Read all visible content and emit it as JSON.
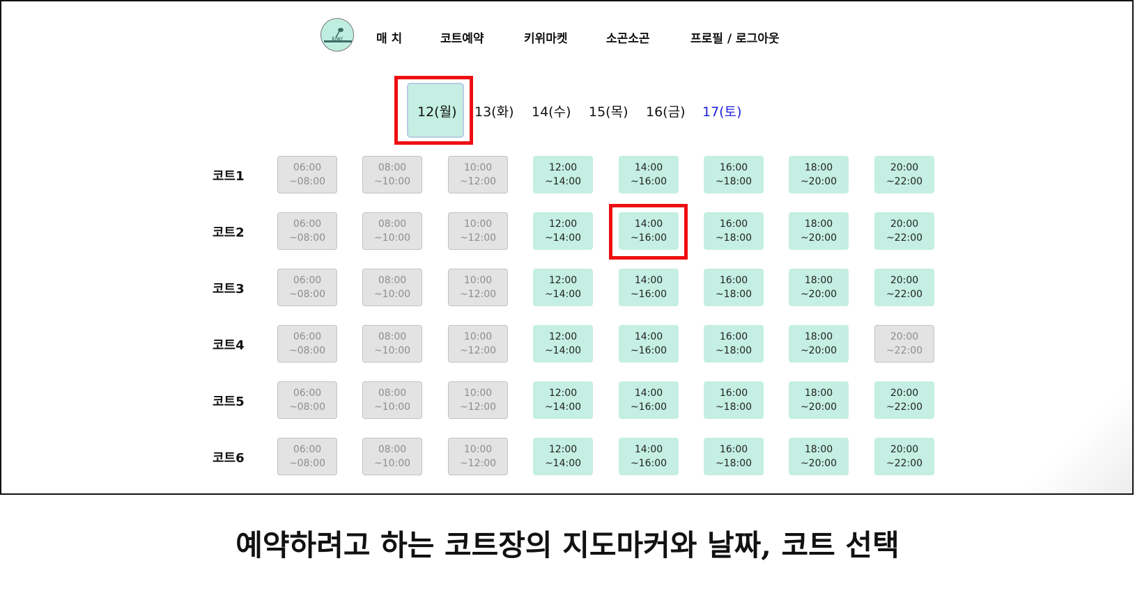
{
  "nav": {
    "logo_text": "kiwi",
    "items": [
      "매 치",
      "코트예약",
      "키위마켓",
      "소곤소곤",
      "프로필 / 로그아웃"
    ]
  },
  "dates": [
    {
      "label": "12(월)",
      "selected": true,
      "saturday": false
    },
    {
      "label": "13(화)",
      "selected": false,
      "saturday": false
    },
    {
      "label": "14(수)",
      "selected": false,
      "saturday": false
    },
    {
      "label": "15(목)",
      "selected": false,
      "saturday": false
    },
    {
      "label": "16(금)",
      "selected": false,
      "saturday": false
    },
    {
      "label": "17(토)",
      "selected": false,
      "saturday": true
    }
  ],
  "courts": [
    {
      "name": "코트1",
      "slots": [
        {
          "start": "06:00",
          "end": "~08:00",
          "available": false
        },
        {
          "start": "08:00",
          "end": "~10:00",
          "available": false
        },
        {
          "start": "10:00",
          "end": "~12:00",
          "available": false
        },
        {
          "start": "12:00",
          "end": "~14:00",
          "available": true
        },
        {
          "start": "14:00",
          "end": "~16:00",
          "available": true
        },
        {
          "start": "16:00",
          "end": "~18:00",
          "available": true
        },
        {
          "start": "18:00",
          "end": "~20:00",
          "available": true
        },
        {
          "start": "20:00",
          "end": "~22:00",
          "available": true
        }
      ]
    },
    {
      "name": "코트2",
      "slots": [
        {
          "start": "06:00",
          "end": "~08:00",
          "available": false
        },
        {
          "start": "08:00",
          "end": "~10:00",
          "available": false
        },
        {
          "start": "10:00",
          "end": "~12:00",
          "available": false
        },
        {
          "start": "12:00",
          "end": "~14:00",
          "available": true
        },
        {
          "start": "14:00",
          "end": "~16:00",
          "available": true
        },
        {
          "start": "16:00",
          "end": "~18:00",
          "available": true
        },
        {
          "start": "18:00",
          "end": "~20:00",
          "available": true
        },
        {
          "start": "20:00",
          "end": "~22:00",
          "available": true
        }
      ]
    },
    {
      "name": "코트3",
      "slots": [
        {
          "start": "06:00",
          "end": "~08:00",
          "available": false
        },
        {
          "start": "08:00",
          "end": "~10:00",
          "available": false
        },
        {
          "start": "10:00",
          "end": "~12:00",
          "available": false
        },
        {
          "start": "12:00",
          "end": "~14:00",
          "available": true
        },
        {
          "start": "14:00",
          "end": "~16:00",
          "available": true
        },
        {
          "start": "16:00",
          "end": "~18:00",
          "available": true
        },
        {
          "start": "18:00",
          "end": "~20:00",
          "available": true
        },
        {
          "start": "20:00",
          "end": "~22:00",
          "available": true
        }
      ]
    },
    {
      "name": "코트4",
      "slots": [
        {
          "start": "06:00",
          "end": "~08:00",
          "available": false
        },
        {
          "start": "08:00",
          "end": "~10:00",
          "available": false
        },
        {
          "start": "10:00",
          "end": "~12:00",
          "available": false
        },
        {
          "start": "12:00",
          "end": "~14:00",
          "available": true
        },
        {
          "start": "14:00",
          "end": "~16:00",
          "available": true
        },
        {
          "start": "16:00",
          "end": "~18:00",
          "available": true
        },
        {
          "start": "18:00",
          "end": "~20:00",
          "available": true
        },
        {
          "start": "20:00",
          "end": "~22:00",
          "available": false
        }
      ]
    },
    {
      "name": "코트5",
      "slots": [
        {
          "start": "06:00",
          "end": "~08:00",
          "available": false
        },
        {
          "start": "08:00",
          "end": "~10:00",
          "available": false
        },
        {
          "start": "10:00",
          "end": "~12:00",
          "available": false
        },
        {
          "start": "12:00",
          "end": "~14:00",
          "available": true
        },
        {
          "start": "14:00",
          "end": "~16:00",
          "available": true
        },
        {
          "start": "16:00",
          "end": "~18:00",
          "available": true
        },
        {
          "start": "18:00",
          "end": "~20:00",
          "available": true
        },
        {
          "start": "20:00",
          "end": "~22:00",
          "available": true
        }
      ]
    },
    {
      "name": "코트6",
      "slots": [
        {
          "start": "06:00",
          "end": "~08:00",
          "available": false
        },
        {
          "start": "08:00",
          "end": "~10:00",
          "available": false
        },
        {
          "start": "10:00",
          "end": "~12:00",
          "available": false
        },
        {
          "start": "12:00",
          "end": "~14:00",
          "available": true
        },
        {
          "start": "14:00",
          "end": "~16:00",
          "available": true
        },
        {
          "start": "16:00",
          "end": "~18:00",
          "available": true
        },
        {
          "start": "18:00",
          "end": "~20:00",
          "available": true
        },
        {
          "start": "20:00",
          "end": "~22:00",
          "available": true
        }
      ]
    }
  ],
  "highlights": {
    "date_index": 0,
    "court_index": 1,
    "slot_index": 4
  },
  "caption": "예약하려고 하는 코트장의 지도마커와 날짜, 코트 선택",
  "colors": {
    "available": "#c4efe2",
    "unavailable": "#e3e3e3",
    "highlight": "#ee0f12",
    "saturday": "#1d1de0"
  }
}
